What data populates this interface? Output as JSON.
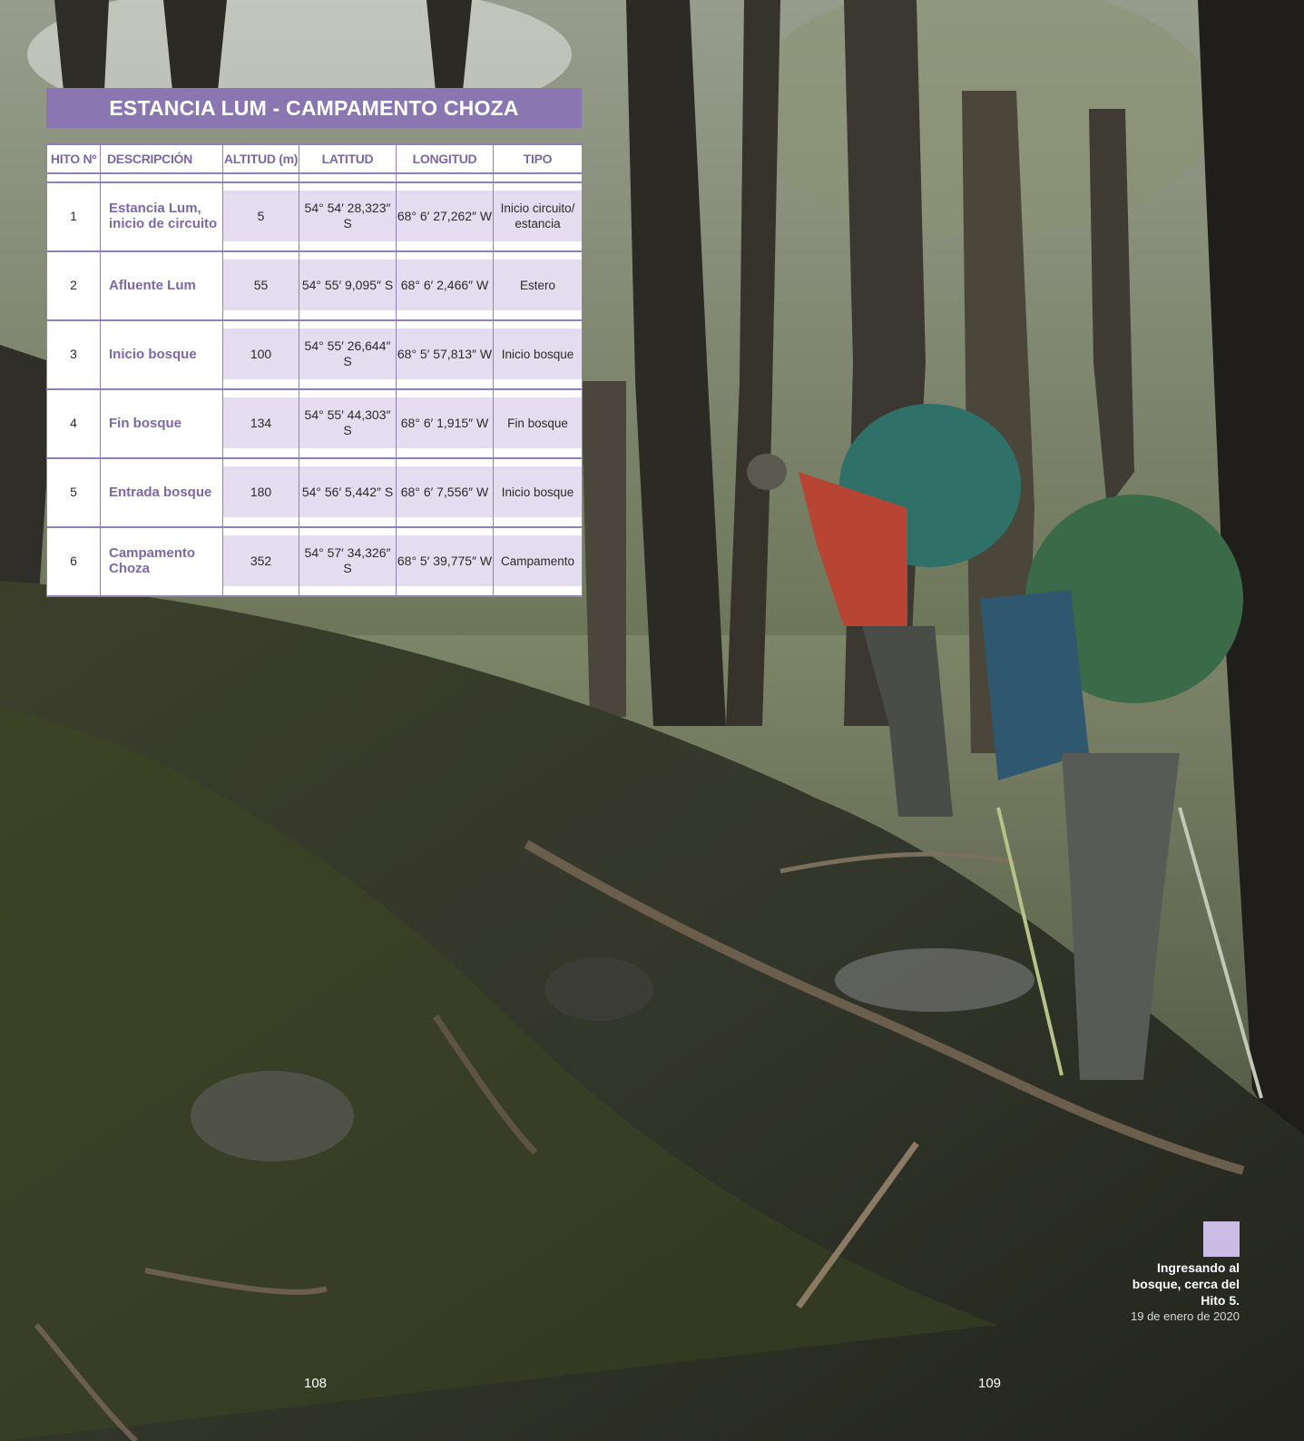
{
  "table": {
    "title": "ESTANCIA LUM - CAMPAMENTO CHOZA",
    "headers": [
      "HITO Nº",
      "DESCRIPCIÓN",
      "ALTITUD (m)",
      "LATITUD",
      "LONGITUD",
      "TIPO"
    ],
    "rows": [
      {
        "hito": "1",
        "descripcion": "Estancia Lum, inicio de circuito",
        "altitud": "5",
        "latitud": "54° 54′ 28,323″ S",
        "longitud": "68° 6′ 27,262″ W",
        "tipo": "Inicio circuito/ estancia"
      },
      {
        "hito": "2",
        "descripcion": "Afluente Lum",
        "altitud": "55",
        "latitud": "54° 55′ 9,095″ S",
        "longitud": "68° 6′ 2,466″ W",
        "tipo": "Estero"
      },
      {
        "hito": "3",
        "descripcion": "Inicio bosque",
        "altitud": "100",
        "latitud": "54° 55′ 26,644″ S",
        "longitud": "68° 5′ 57,813″ W",
        "tipo": "Inicio bosque"
      },
      {
        "hito": "4",
        "descripcion": "Fin bosque",
        "altitud": "134",
        "latitud": "54° 55′ 44,303″ S",
        "longitud": "68° 6′ 1,915″ W",
        "tipo": "Fin bosque"
      },
      {
        "hito": "5",
        "descripcion": "Entrada bosque",
        "altitud": "180",
        "latitud": "54° 56′ 5,442″ S",
        "longitud": "68° 6′ 7,556″ W",
        "tipo": "Inicio bosque"
      },
      {
        "hito": "6",
        "descripcion": "Campamento Choza",
        "altitud": "352",
        "latitud": "54° 57′ 34,326″ S",
        "longitud": "68° 5′ 39,775″ W",
        "tipo": "Campamento"
      }
    ]
  },
  "caption": {
    "bold_text": "Ingresando al bosque, cerca del Hito 5.",
    "date": "19 de enero de 2020"
  },
  "page_numbers": {
    "left": "108",
    "right": "109"
  },
  "colors": {
    "accent_purple": "#8a76b0",
    "header_text": "#7b68a8",
    "cell_fill": "#e4ddf0",
    "caption_square": "#c9bde6"
  }
}
